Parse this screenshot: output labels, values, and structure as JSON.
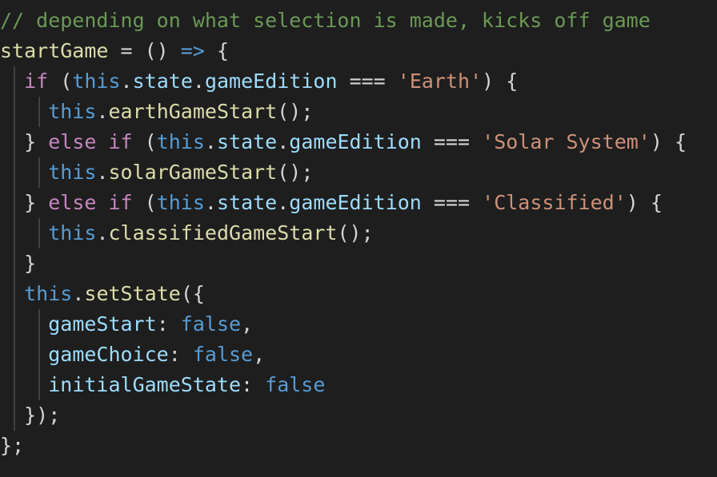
{
  "editor": {
    "background": "#1e1e1e",
    "colors": {
      "comment": "#6a9955",
      "keyword": "#c586c0",
      "this": "#569cd6",
      "variable": "#9cdcfe",
      "function": "#dcdcaa",
      "string": "#ce9178",
      "boolean": "#569cd6",
      "plain": "#d4d4d4",
      "indent_guide": "#404040"
    },
    "lines": [
      {
        "tokens": [
          {
            "type": "comment",
            "text": "// depending on what selection is made, kicks off game"
          }
        ]
      },
      {
        "tokens": [
          {
            "type": "function",
            "text": "startGame"
          },
          {
            "type": "plain",
            "text": " = "
          },
          {
            "type": "plain",
            "text": "() "
          },
          {
            "type": "arrow",
            "text": "=>"
          },
          {
            "type": "plain",
            "text": " {"
          }
        ]
      },
      {
        "tokens": [
          {
            "type": "plain",
            "text": "  "
          },
          {
            "type": "keyword",
            "text": "if"
          },
          {
            "type": "plain",
            "text": " ("
          },
          {
            "type": "this",
            "text": "this"
          },
          {
            "type": "plain",
            "text": "."
          },
          {
            "type": "variable",
            "text": "state"
          },
          {
            "type": "plain",
            "text": "."
          },
          {
            "type": "variable",
            "text": "gameEdition"
          },
          {
            "type": "plain",
            "text": " === "
          },
          {
            "type": "string",
            "text": "'Earth'"
          },
          {
            "type": "plain",
            "text": ") {"
          }
        ]
      },
      {
        "tokens": [
          {
            "type": "plain",
            "text": "    "
          },
          {
            "type": "this",
            "text": "this"
          },
          {
            "type": "plain",
            "text": "."
          },
          {
            "type": "function",
            "text": "earthGameStart"
          },
          {
            "type": "plain",
            "text": "();"
          }
        ]
      },
      {
        "tokens": [
          {
            "type": "plain",
            "text": "  } "
          },
          {
            "type": "keyword",
            "text": "else if"
          },
          {
            "type": "plain",
            "text": " ("
          },
          {
            "type": "this",
            "text": "this"
          },
          {
            "type": "plain",
            "text": "."
          },
          {
            "type": "variable",
            "text": "state"
          },
          {
            "type": "plain",
            "text": "."
          },
          {
            "type": "variable",
            "text": "gameEdition"
          },
          {
            "type": "plain",
            "text": " === "
          },
          {
            "type": "string",
            "text": "'Solar System'"
          },
          {
            "type": "plain",
            "text": ") {"
          }
        ]
      },
      {
        "tokens": [
          {
            "type": "plain",
            "text": "    "
          },
          {
            "type": "this",
            "text": "this"
          },
          {
            "type": "plain",
            "text": "."
          },
          {
            "type": "function",
            "text": "solarGameStart"
          },
          {
            "type": "plain",
            "text": "();"
          }
        ]
      },
      {
        "tokens": [
          {
            "type": "plain",
            "text": "  } "
          },
          {
            "type": "keyword",
            "text": "else if"
          },
          {
            "type": "plain",
            "text": " ("
          },
          {
            "type": "this",
            "text": "this"
          },
          {
            "type": "plain",
            "text": "."
          },
          {
            "type": "variable",
            "text": "state"
          },
          {
            "type": "plain",
            "text": "."
          },
          {
            "type": "variable",
            "text": "gameEdition"
          },
          {
            "type": "plain",
            "text": " === "
          },
          {
            "type": "string",
            "text": "'Classified'"
          },
          {
            "type": "plain",
            "text": ") {"
          }
        ]
      },
      {
        "tokens": [
          {
            "type": "plain",
            "text": "    "
          },
          {
            "type": "this",
            "text": "this"
          },
          {
            "type": "plain",
            "text": "."
          },
          {
            "type": "function",
            "text": "classifiedGameStart"
          },
          {
            "type": "plain",
            "text": "();"
          }
        ]
      },
      {
        "tokens": [
          {
            "type": "plain",
            "text": "  }"
          }
        ]
      },
      {
        "tokens": [
          {
            "type": "plain",
            "text": "  "
          },
          {
            "type": "this",
            "text": "this"
          },
          {
            "type": "plain",
            "text": "."
          },
          {
            "type": "function",
            "text": "setState"
          },
          {
            "type": "plain",
            "text": "({"
          }
        ]
      },
      {
        "tokens": [
          {
            "type": "plain",
            "text": "    "
          },
          {
            "type": "variable",
            "text": "gameStart"
          },
          {
            "type": "plain",
            "text": ": "
          },
          {
            "type": "boolean",
            "text": "false"
          },
          {
            "type": "plain",
            "text": ","
          }
        ]
      },
      {
        "tokens": [
          {
            "type": "plain",
            "text": "    "
          },
          {
            "type": "variable",
            "text": "gameChoice"
          },
          {
            "type": "plain",
            "text": ": "
          },
          {
            "type": "boolean",
            "text": "false"
          },
          {
            "type": "plain",
            "text": ","
          }
        ]
      },
      {
        "tokens": [
          {
            "type": "plain",
            "text": "    "
          },
          {
            "type": "variable",
            "text": "initialGameState"
          },
          {
            "type": "plain",
            "text": ": "
          },
          {
            "type": "boolean",
            "text": "false"
          }
        ]
      },
      {
        "tokens": [
          {
            "type": "plain",
            "text": "  });"
          }
        ]
      },
      {
        "tokens": [
          {
            "type": "plain",
            "text": "};"
          }
        ]
      }
    ]
  }
}
